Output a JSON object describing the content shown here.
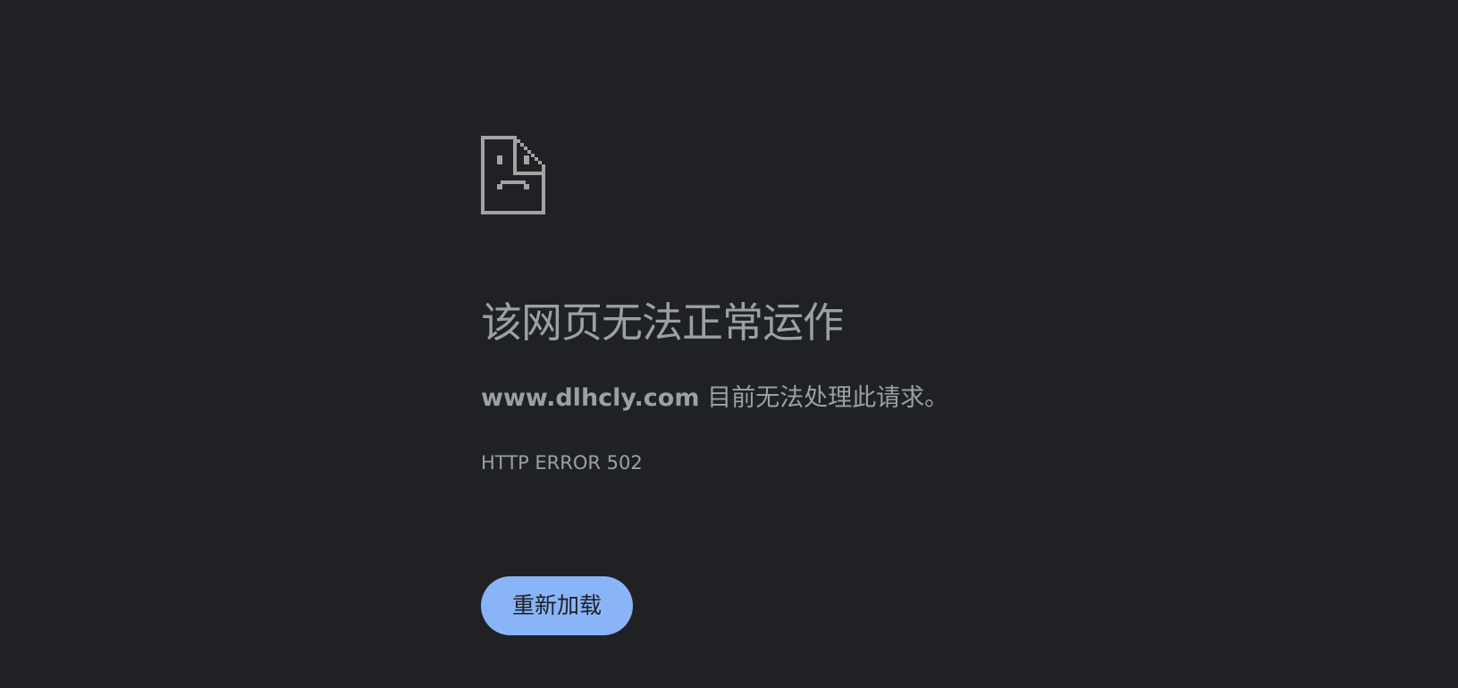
{
  "error_page": {
    "icon": "sad-page-icon",
    "title": "该网页无法正常运作",
    "host": "www.dlhcly.com",
    "summary_suffix": "目前无法处理此请求。",
    "error_code": "HTTP ERROR 502",
    "reload_label": "重新加载"
  },
  "colors": {
    "background": "#202124",
    "text": "#9aa0a6",
    "button": "#8ab4f8",
    "button_text": "#202124"
  }
}
